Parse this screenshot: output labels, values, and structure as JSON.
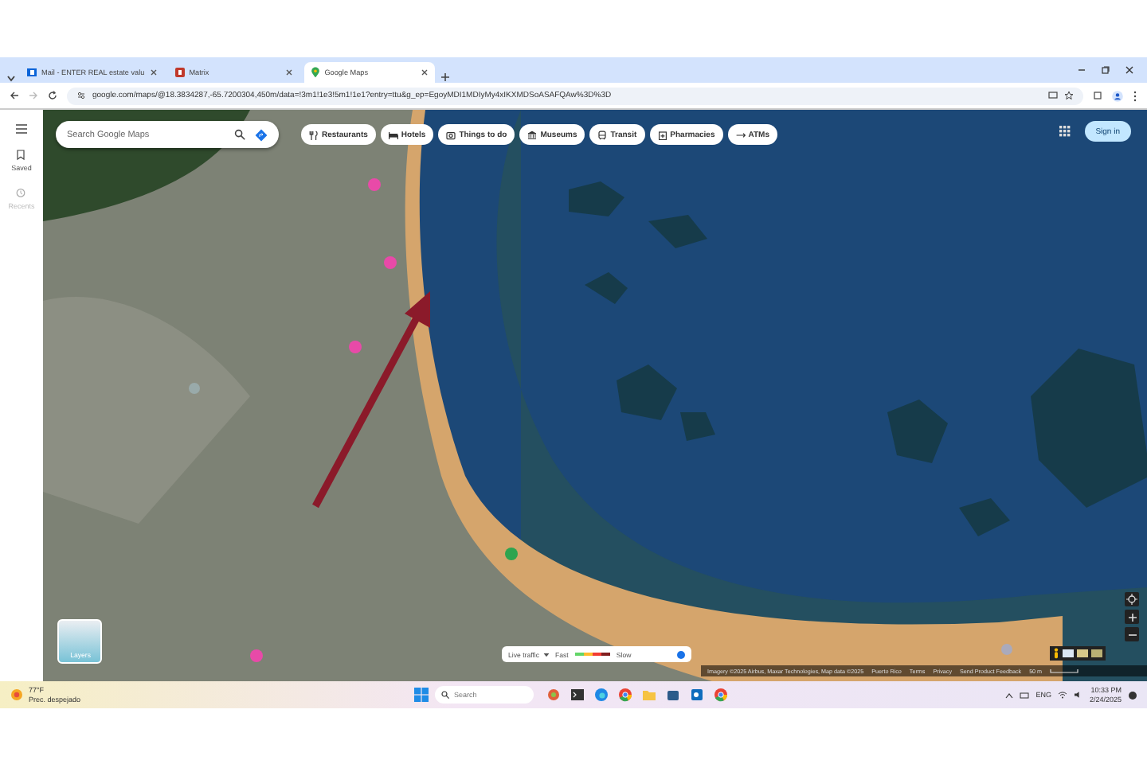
{
  "browser": {
    "tabs": [
      {
        "title": "Mail - ENTER REAL estate valu",
        "kind": "mail",
        "selected": false
      },
      {
        "title": "Matrix",
        "kind": "matrix",
        "selected": false
      },
      {
        "title": "Google Maps",
        "kind": "maps",
        "selected": true
      }
    ],
    "address": "google.com/maps/@18.3834287,-65.7200304,450m/data=!3m1!1e3!5m1!1e1?entry=ttu&g_ep=EgoyMDI1MDIyMy4xIKXMDSoASAFQAw%3D%3D"
  },
  "maps": {
    "search": {
      "placeholder": "Search Google Maps"
    },
    "chips": [
      {
        "label": "Restaurants",
        "kind": "restaurants"
      },
      {
        "label": "Hotels",
        "kind": "hotels"
      },
      {
        "label": "Things to do",
        "kind": "things"
      },
      {
        "label": "Museums",
        "kind": "museums"
      },
      {
        "label": "Transit",
        "kind": "transit"
      },
      {
        "label": "Pharmacies",
        "kind": "pharmacies"
      },
      {
        "label": "ATMs",
        "kind": "atms"
      }
    ],
    "sidebar": [
      {
        "label": "Saved",
        "kind": "saved",
        "disabled": false
      },
      {
        "label": "Recents",
        "kind": "recents",
        "disabled": true
      }
    ],
    "sign_in": "Sign in",
    "layers": "Layers",
    "traffic": {
      "label": "Live traffic",
      "fast": "Fast",
      "slow": "Slow",
      "on": true
    },
    "attribution": [
      "Imagery ©2025 Airbus, Maxar Technologies, Map data ©2025",
      "Puerto Rico",
      "Terms",
      "Privacy",
      "Send Product Feedback"
    ],
    "scale": "50 m"
  },
  "taskbar": {
    "weather": {
      "temp": "77°F",
      "condition": "Prec. despejado"
    },
    "search_placeholder": "Search",
    "language": "ENG",
    "time": "10:33 PM",
    "date": "2/24/2025"
  }
}
